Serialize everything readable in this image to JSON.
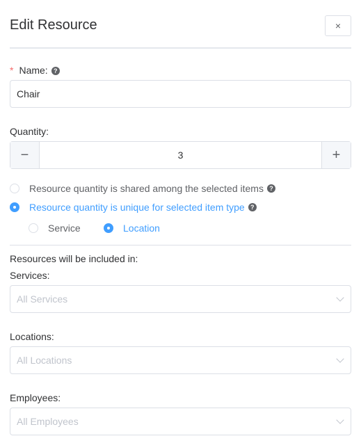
{
  "dialog": {
    "title": "Edit Resource",
    "close_icon": "×"
  },
  "name": {
    "label": "Name:",
    "required_mark": "*",
    "value": "Chair"
  },
  "quantity": {
    "label": "Quantity:",
    "value": "3",
    "minus": "−",
    "plus": "+"
  },
  "mode": {
    "options": [
      {
        "label": "Resource quantity is shared among the selected items",
        "selected": false
      },
      {
        "label": "Resource quantity is unique for selected item type",
        "selected": true
      }
    ]
  },
  "item_type": {
    "options": [
      {
        "label": "Service",
        "selected": false
      },
      {
        "label": "Location",
        "selected": true
      }
    ]
  },
  "included": {
    "heading": "Resources will be included in:",
    "services": {
      "label": "Services:",
      "placeholder": "All Services"
    },
    "locations": {
      "label": "Locations:",
      "placeholder": "All Locations"
    },
    "employees": {
      "label": "Employees:",
      "placeholder": "All Employees"
    }
  },
  "colors": {
    "accent": "#409eff",
    "required": "#f56c6c"
  }
}
